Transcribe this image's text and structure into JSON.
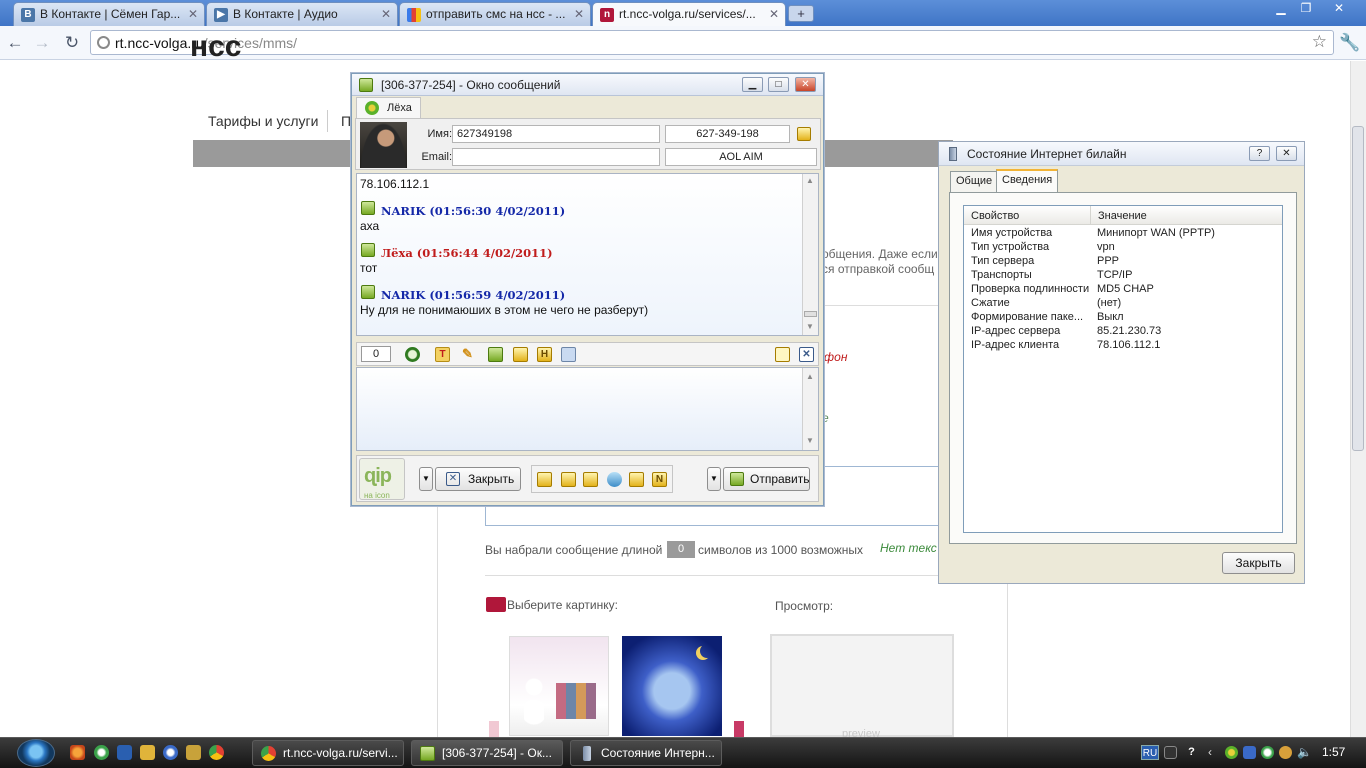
{
  "browser": {
    "tabs": [
      {
        "title": "В Контакте | Сёмен Гар..."
      },
      {
        "title": "В Контакте | Аудио"
      },
      {
        "title": "отправить смс на нсс - ..."
      },
      {
        "title": "rt.ncc-volga.ru/services/..."
      }
    ],
    "url_host": "rt.ncc-volga.ru",
    "url_path": "/services/mms/"
  },
  "page": {
    "logo_text": "нсс",
    "nav_item": "Тарифы и услуги",
    "nav_item_partial": "П",
    "desc_line1": "общения. Даже если",
    "desc_line2": "ся отправкой сообщ",
    "phone_label": "фон",
    "partial_e": "е",
    "length_prefix": "Вы набрали сообщение длиной",
    "length_value": "0",
    "length_suffix": "символов из 1000 возможных",
    "no_text": "Нет текс",
    "choose_picture": "Выберите картинку:",
    "preview_label": "Просмотр:",
    "preview_watermark": "preview"
  },
  "qip": {
    "title": "[306-377-254] - Окно сообщений",
    "contact_tab": "Лёха",
    "name_label": "Имя:",
    "name_value": "627349198",
    "uin_value": "627-349-198",
    "email_label": "Email:",
    "email_value": "",
    "protocol": "AOL AIM",
    "messages": [
      {
        "header": "",
        "text": "78.106.112.1",
        "color": "#c01c1c"
      },
      {
        "header": "NARIK (01:56:30 4/02/2011)",
        "text": "аха",
        "color": "#1428a8"
      },
      {
        "header": "Лёха (01:56:44 4/02/2011)",
        "text": "тот",
        "color": "#c01c1c"
      },
      {
        "header": "NARIK (01:56:59 4/02/2011)",
        "text": "Ну для не понимаюших в этом не чего не разберут)",
        "color": "#1428a8"
      }
    ],
    "char_counter": "0",
    "close_button": "Закрыть",
    "send_button": "Отправить",
    "logo_text": "на icon"
  },
  "status_window": {
    "title": "Состояние Интернет билайн",
    "tabs": [
      "Общие",
      "Сведения"
    ],
    "active_tab": "Сведения",
    "columns": [
      "Свойство",
      "Значение"
    ],
    "rows": [
      {
        "property": "Имя устройства",
        "value": "Минипорт WAN (PPTP)"
      },
      {
        "property": "Тип устройства",
        "value": "vpn"
      },
      {
        "property": "Тип сервера",
        "value": "PPP"
      },
      {
        "property": "Транспорты",
        "value": "TCP/IP"
      },
      {
        "property": "Проверка подлинности",
        "value": "MD5 CHAP"
      },
      {
        "property": "Сжатие",
        "value": "(нет)"
      },
      {
        "property": "Формирование паке...",
        "value": "Выкл"
      },
      {
        "property": "IP-адрес сервера",
        "value": "85.21.230.73"
      },
      {
        "property": "IP-адрес клиента",
        "value": "78.106.112.1"
      }
    ],
    "close_button": "Закрыть"
  },
  "taskbar": {
    "tasks": [
      {
        "label": "rt.ncc-volga.ru/servi..."
      },
      {
        "label": "[306-377-254] - Ок..."
      },
      {
        "label": "Состояние Интерн..."
      }
    ],
    "lang": "RU",
    "time": "1:57"
  }
}
